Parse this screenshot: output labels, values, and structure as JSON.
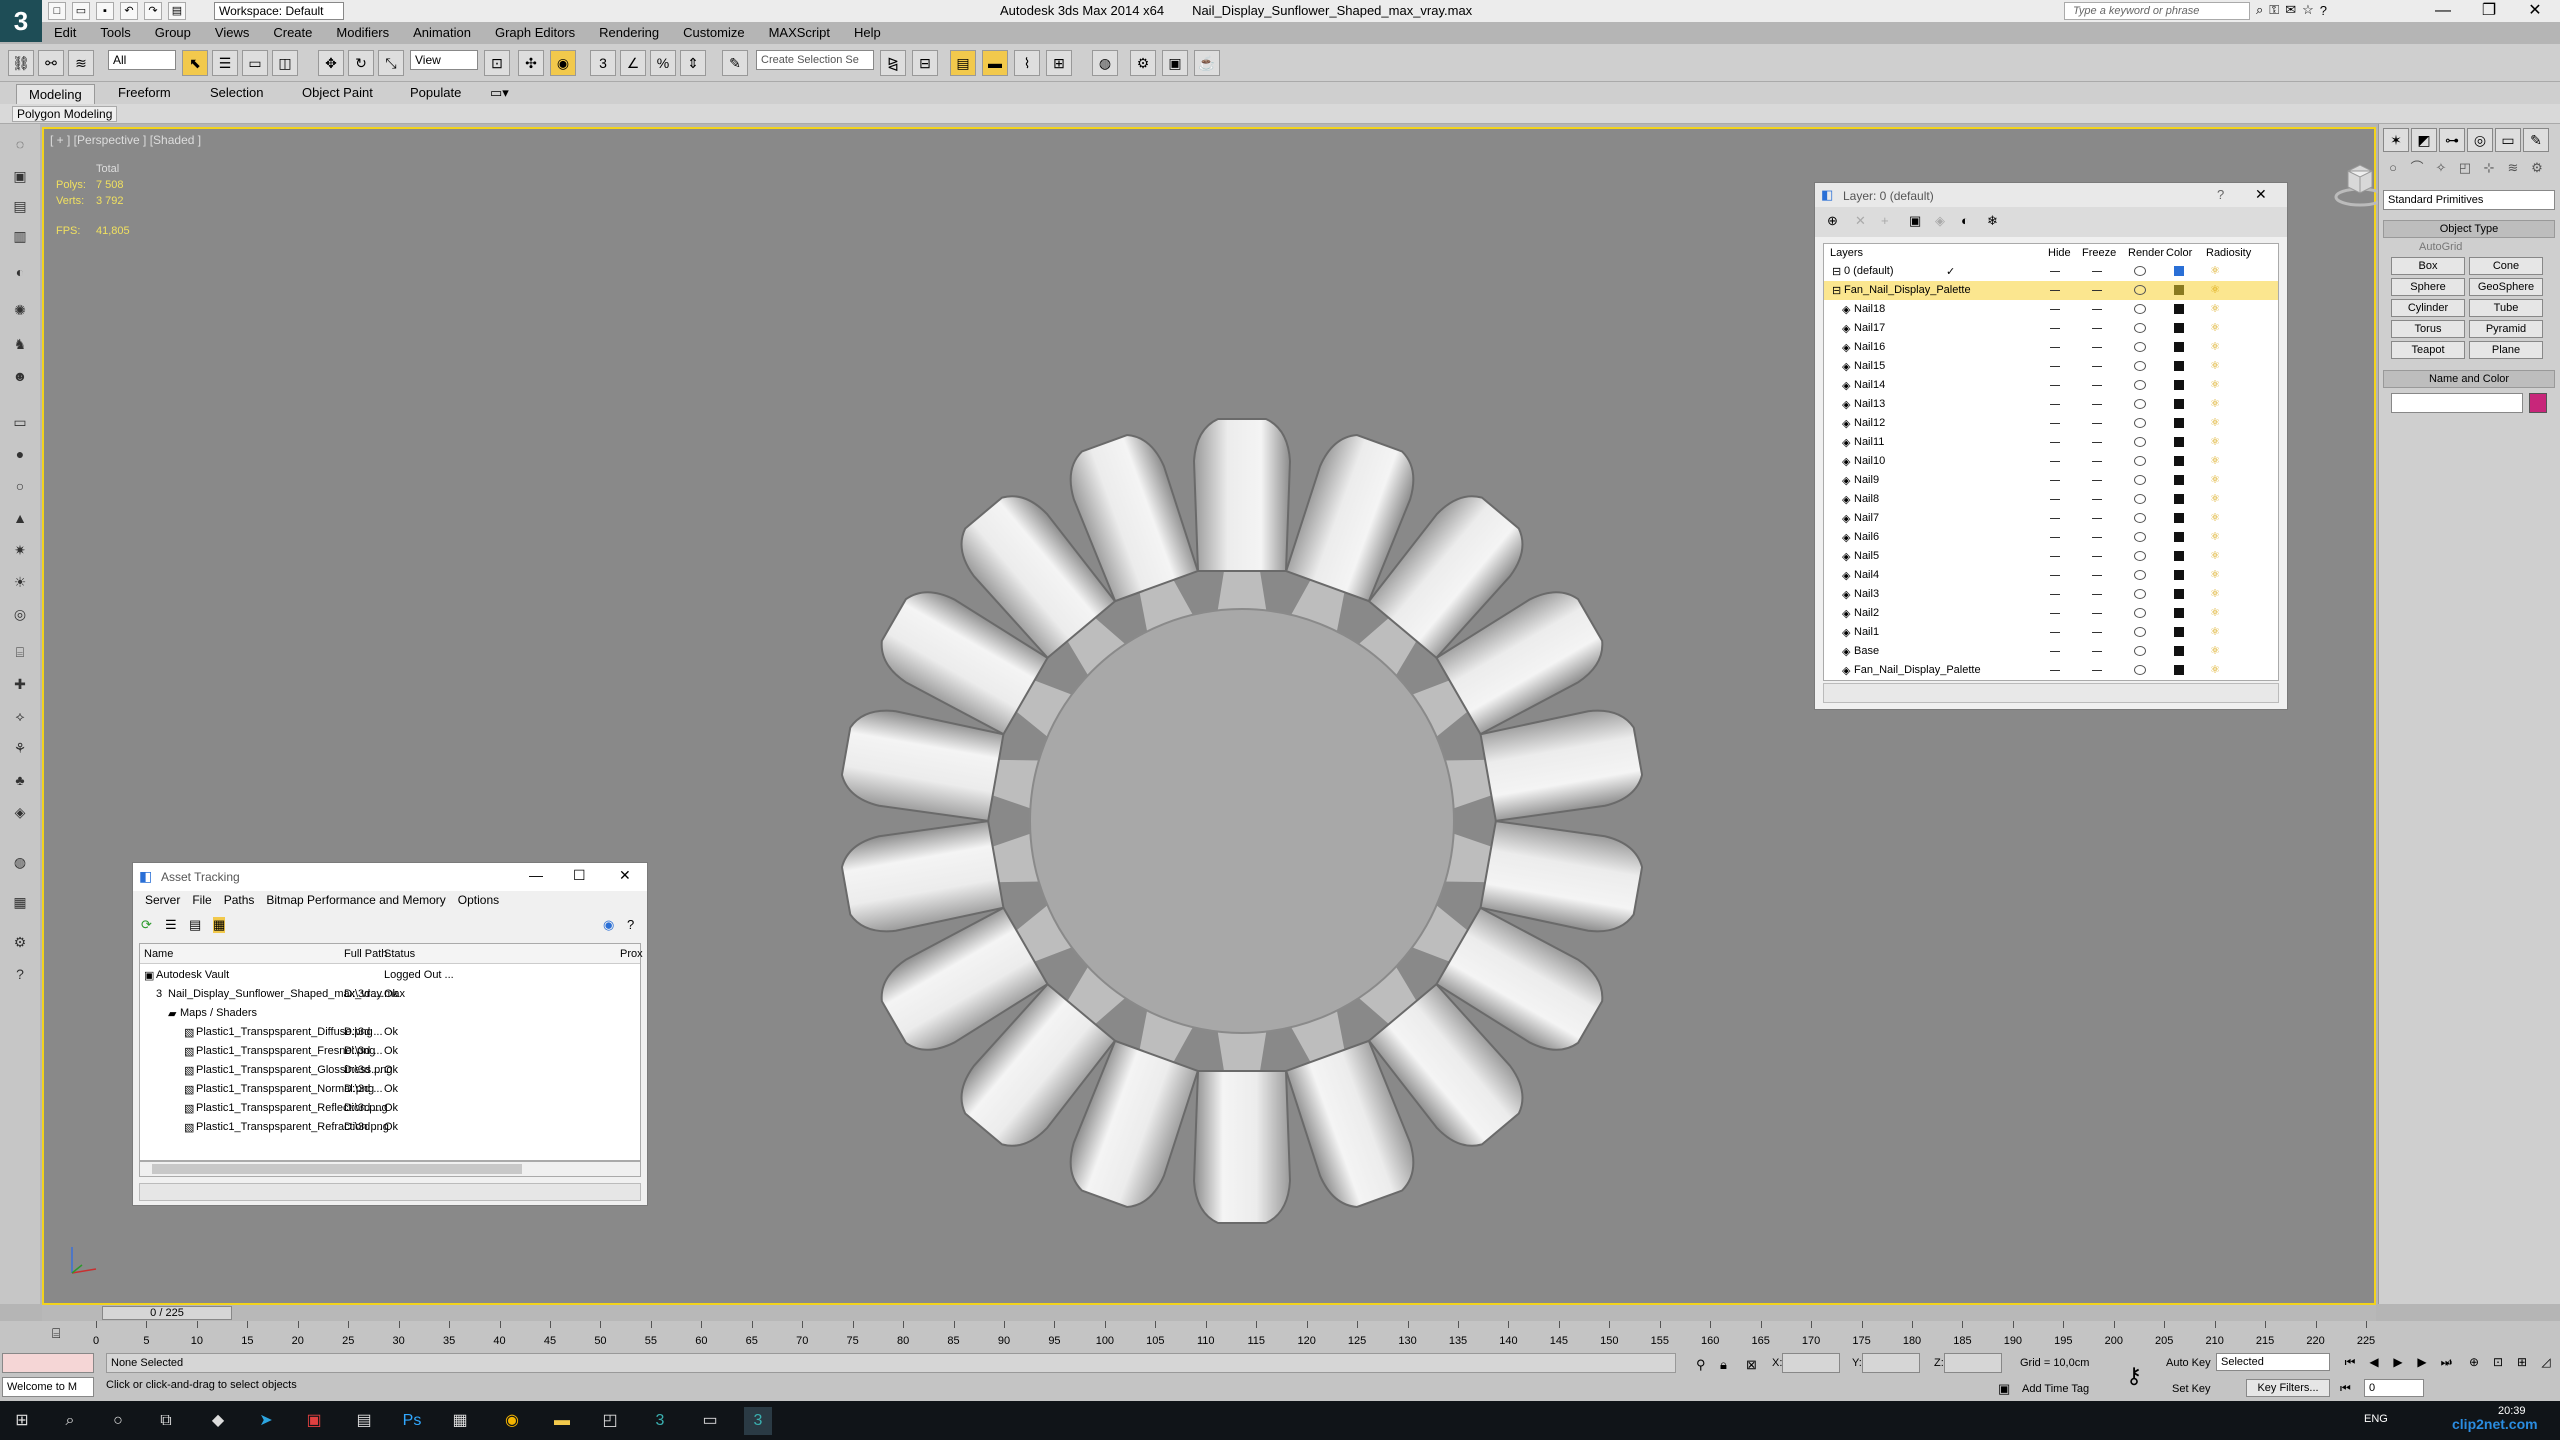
{
  "app": {
    "title": "Autodesk 3ds Max  2014 x64",
    "file": "Nail_Display_Sunflower_Shaped_max_vray.max",
    "workspace": "Workspace: Default",
    "search_placeholder": "Type a keyword or phrase"
  },
  "menu": [
    "Edit",
    "Tools",
    "Group",
    "Views",
    "Create",
    "Modifiers",
    "Animation",
    "Graph Editors",
    "Rendering",
    "Customize",
    "MAXScript",
    "Help"
  ],
  "toolbar": {
    "selection_filter": "All",
    "ref_coord": "View",
    "named_selection": "Create Selection Se"
  },
  "ribbon": {
    "tabs": [
      "Modeling",
      "Freeform",
      "Selection",
      "Object Paint",
      "Populate"
    ],
    "panel": "Polygon Modeling"
  },
  "viewport": {
    "label": "[ + ] [Perspective ] [Shaded ]",
    "stats_header": "Total",
    "polys_label": "Polys:",
    "polys_value": "7 508",
    "verts_label": "Verts:",
    "verts_value": "3 792",
    "fps_label": "FPS:",
    "fps_value": "41,805"
  },
  "command_panel": {
    "category": "Standard Primitives",
    "object_type_header": "Object Type",
    "autogrid": "AutoGrid",
    "primitives": [
      "Box",
      "Cone",
      "Sphere",
      "GeoSphere",
      "Cylinder",
      "Tube",
      "Torus",
      "Pyramid",
      "Teapot",
      "Plane"
    ],
    "name_color_header": "Name and Color",
    "color": "#c8267a"
  },
  "layer_window": {
    "title": "Layer: 0 (default)",
    "columns": [
      "Layers",
      "Hide",
      "Freeze",
      "Render",
      "Color",
      "Radiosity"
    ],
    "rows": [
      {
        "name": "0 (default)",
        "color": "#2a6fd6"
      },
      {
        "name": "Fan_Nail_Display_Palette",
        "color": "#8a7a20"
      },
      {
        "name": "Nail18"
      },
      {
        "name": "Nail17"
      },
      {
        "name": "Nail16"
      },
      {
        "name": "Nail15"
      },
      {
        "name": "Nail14"
      },
      {
        "name": "Nail13"
      },
      {
        "name": "Nail12"
      },
      {
        "name": "Nail11"
      },
      {
        "name": "Nail10"
      },
      {
        "name": "Nail9"
      },
      {
        "name": "Nail8"
      },
      {
        "name": "Nail7"
      },
      {
        "name": "Nail6"
      },
      {
        "name": "Nail5"
      },
      {
        "name": "Nail4"
      },
      {
        "name": "Nail3"
      },
      {
        "name": "Nail2"
      },
      {
        "name": "Nail1"
      },
      {
        "name": "Base"
      },
      {
        "name": "Fan_Nail_Display_Palette"
      }
    ]
  },
  "asset_window": {
    "title": "Asset Tracking",
    "menu": [
      "Server",
      "File",
      "Paths",
      "Bitmap Performance and Memory",
      "Options"
    ],
    "columns": [
      "Name",
      "Full Path",
      "Status",
      "Prox"
    ],
    "rows": [
      {
        "name": "Autodesk Vault",
        "path": "",
        "status": "Logged Out ..."
      },
      {
        "name": "Nail_Display_Sunflower_Shaped_max_vray.max",
        "path": "D:\\3d ...",
        "status": "Ok"
      },
      {
        "name": "Maps / Shaders",
        "path": "",
        "status": ""
      },
      {
        "name": "Plastic1_Transpsparent_Diffuse.png",
        "path": "D:\\3d ...",
        "status": "Ok"
      },
      {
        "name": "Plastic1_Transpsparent_Fresnel.png",
        "path": "D:\\3d ...",
        "status": "Ok"
      },
      {
        "name": "Plastic1_Transpsparent_Glossiness.png",
        "path": "D:\\3d ...",
        "status": "Ok"
      },
      {
        "name": "Plastic1_Transpsparent_Normal.png",
        "path": "D:\\3d ...",
        "status": "Ok"
      },
      {
        "name": "Plastic1_Transpsparent_Reflection.png",
        "path": "D:\\3d ...",
        "status": "Ok"
      },
      {
        "name": "Plastic1_Transpsparent_Refraction.png",
        "path": "D:\\3d ...",
        "status": "Ok"
      }
    ]
  },
  "timeline": {
    "frame_counter": "0 / 225",
    "ticks": [
      "0",
      "5",
      "10",
      "15",
      "20",
      "25",
      "30",
      "35",
      "40",
      "45",
      "50",
      "55",
      "60",
      "65",
      "70",
      "75",
      "80",
      "85",
      "90",
      "95",
      "100",
      "105",
      "110",
      "115",
      "120",
      "125",
      "130",
      "135",
      "140",
      "145",
      "150",
      "155",
      "160",
      "165",
      "170",
      "175",
      "180",
      "185",
      "190",
      "195",
      "200",
      "205",
      "210",
      "215",
      "220",
      "225"
    ]
  },
  "status": {
    "selection": "None Selected",
    "prompt": "Click or click-and-drag to select objects",
    "welcome": "Welcome to M",
    "x_label": "X:",
    "y_label": "Y:",
    "z_label": "Z:",
    "grid": "Grid = 10,0cm",
    "add_time_tag": "Add Time Tag",
    "auto_key": "Auto Key",
    "set_key": "Set Key",
    "selected": "Selected",
    "key_filters": "Key Filters...",
    "current_frame": "0"
  },
  "taskbar": {
    "lang": "ENG",
    "time": "20:39",
    "watermark": "clip2net.com"
  }
}
